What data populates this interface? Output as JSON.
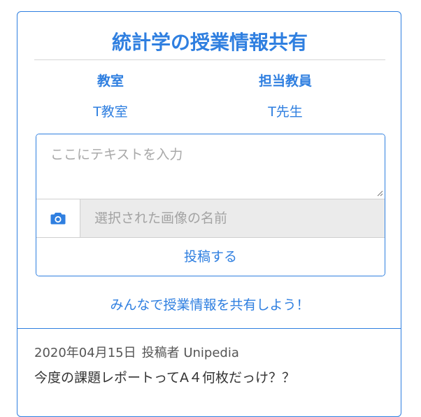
{
  "card": {
    "title": "統計学の授業情報共有",
    "info": [
      {
        "heading": "教室",
        "value": "T教室"
      },
      {
        "heading": "担当教員",
        "value": "T先生"
      }
    ]
  },
  "form": {
    "text_placeholder": "ここにテキストを入力",
    "text_value": "",
    "camera_icon": "camera-icon",
    "file_placeholder": "選択された画像の名前",
    "submit_label": "投稿する"
  },
  "cta": "みんなで授業情報を共有しよう！",
  "posts": [
    {
      "date": "2020年04月15日",
      "author_label": "投稿者 Unipedia",
      "body": "今度の課題レポートってA４何枚だっけ？？"
    }
  ],
  "colors": {
    "accent": "#2f7fe0",
    "file_bg": "#ebebeb"
  }
}
